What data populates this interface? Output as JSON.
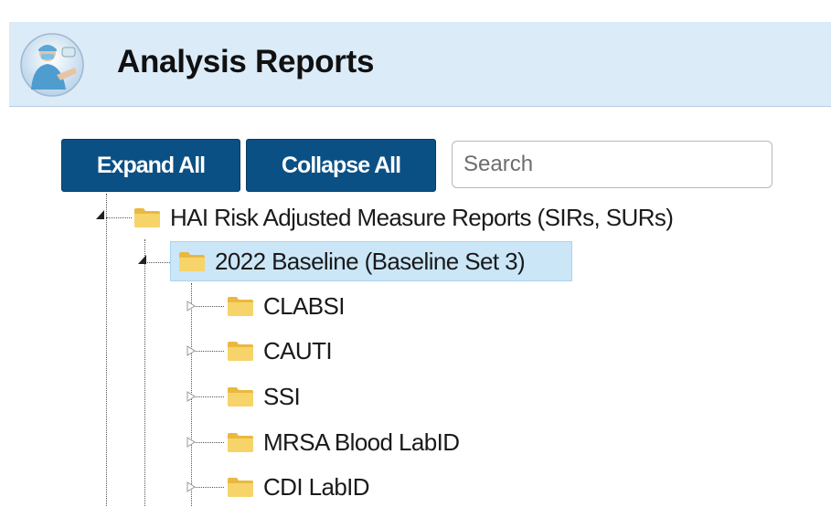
{
  "header": {
    "title": "Analysis Reports",
    "avatar_icon": "healthcare-worker-icon"
  },
  "toolbar": {
    "expand_all_label": "Expand All",
    "collapse_all_label": "Collapse All",
    "search_placeholder": "Search"
  },
  "colors": {
    "header_bg": "#dcebf8",
    "button_bg": "#0b5085",
    "selected_bg": "#cbe6f7",
    "folder": "#f2cd58"
  },
  "tree": {
    "root": {
      "label": "HAI Risk Adjusted Measure Reports (SIRs, SURs)",
      "expanded": true,
      "child": {
        "label": "2022 Baseline (Baseline Set 3)",
        "expanded": true,
        "selected": true,
        "children": [
          {
            "label": "CLABSI",
            "expanded": false
          },
          {
            "label": "CAUTI",
            "expanded": false
          },
          {
            "label": "SSI",
            "expanded": false
          },
          {
            "label": "MRSA Blood LabID",
            "expanded": false
          },
          {
            "label": "CDI LabID",
            "expanded": false
          }
        ]
      }
    }
  }
}
